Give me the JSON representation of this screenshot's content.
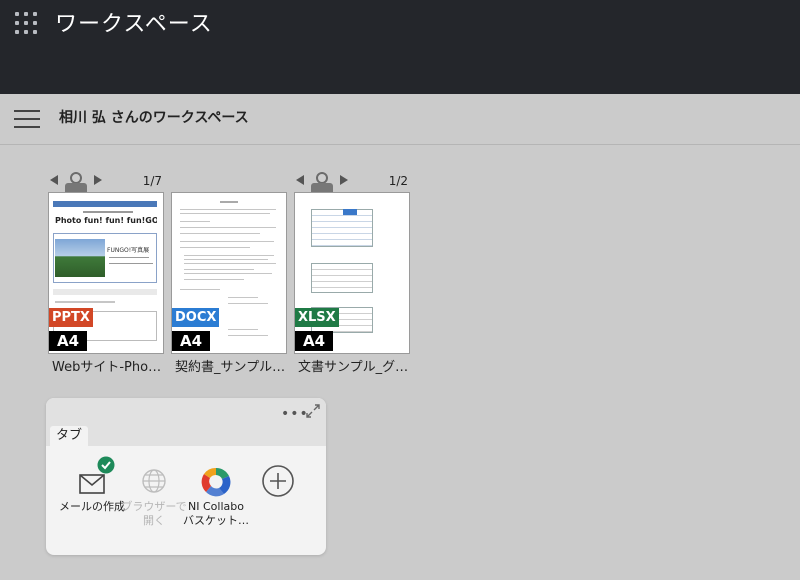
{
  "app": {
    "title": "ワークスペース",
    "menu_icon": "apps-grid-icon"
  },
  "workspace": {
    "title": "相川 弘 さんのワークスペース"
  },
  "documents": [
    {
      "type": "PPTX",
      "size": "A4",
      "pages": "1/7",
      "name": "Webサイト-Photo-",
      "color": "#d24726"
    },
    {
      "type": "DOCX",
      "size": "A4",
      "pages": "",
      "name": "契約書_サンプル…",
      "color": "#2b7cd3"
    },
    {
      "type": "XLSX",
      "size": "A4",
      "pages": "1/2",
      "name": "文書サンプル_グ…",
      "color": "#1f7a45"
    }
  ],
  "thumb_text": {
    "pptx_banner": "Photo fun! fun! fun!GO!",
    "pptx_heading": "FUNGO!写真展"
  },
  "panel": {
    "tab_label": "タブ",
    "actions": [
      {
        "label": "メールの作成",
        "icon": "mail-icon",
        "enabled": true
      },
      {
        "label_line1": "ブラウザーで",
        "label_line2": "開く",
        "icon": "globe-icon",
        "enabled": false
      },
      {
        "label_line1": "NI Collabo",
        "label_line2": "バスケット…",
        "icon": "ni-collabo-logo-icon",
        "enabled": true
      },
      {
        "icon": "add-circle-icon",
        "enabled": true
      }
    ]
  }
}
